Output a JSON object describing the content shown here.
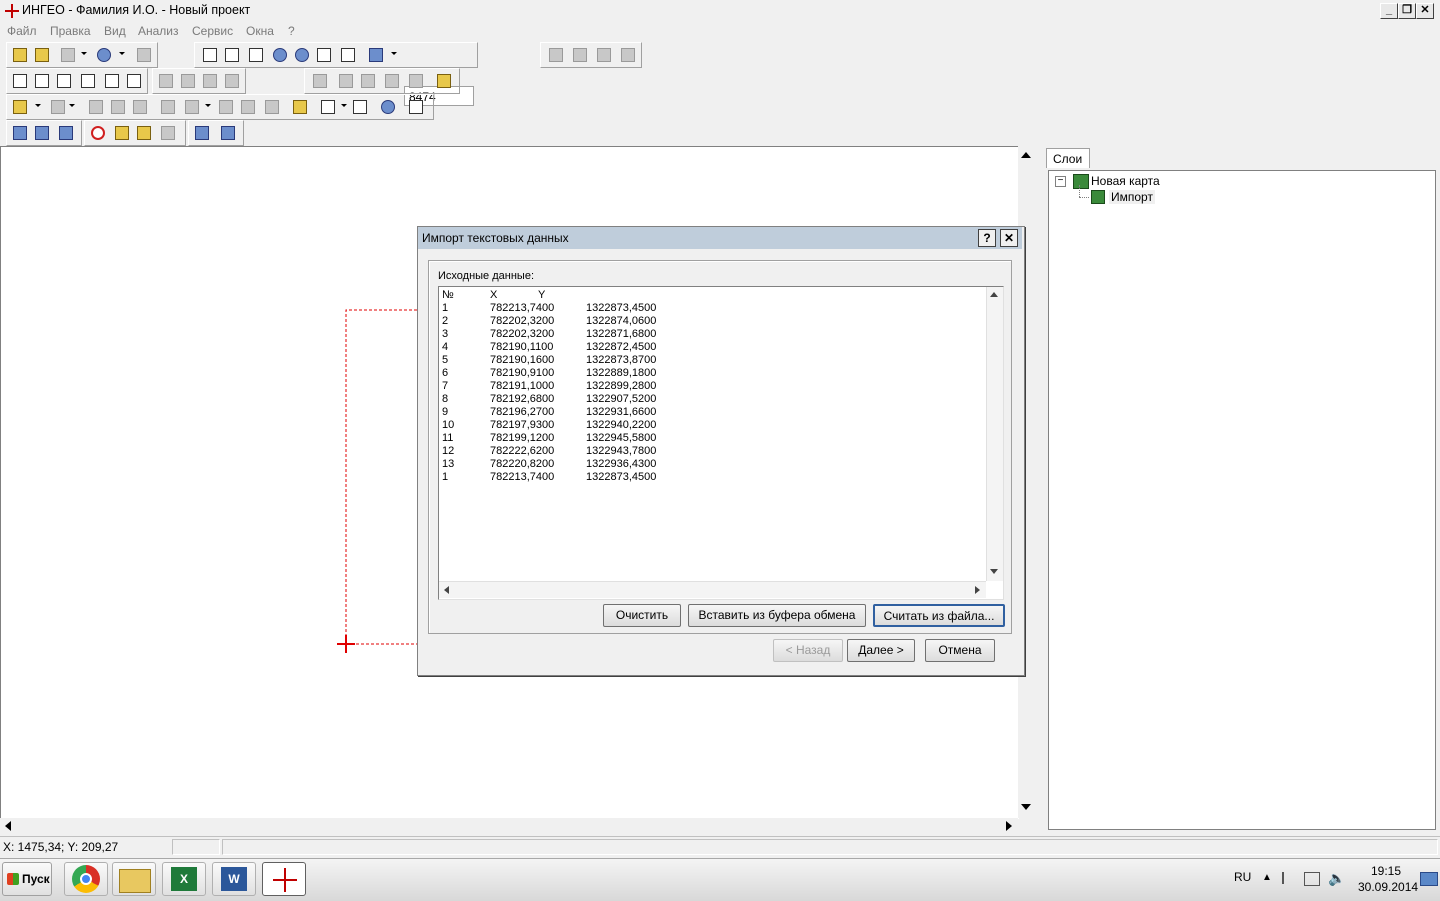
{
  "window": {
    "title": "ИНГЕО - Фамилия И.О. - Новый проект",
    "controls": [
      "minimize-icon",
      "restore-icon",
      "close-icon"
    ]
  },
  "menu": [
    "Файл",
    "Правка",
    "Вид",
    "Анализ",
    "Сервис",
    "Окна",
    "?"
  ],
  "toolbar": {
    "scale_value": "8474"
  },
  "status": {
    "coords": "X: 1475,34; Y: 209,27"
  },
  "layers": {
    "tab_label": "Слои",
    "tree": [
      {
        "label": "Новая карта",
        "children": [
          {
            "label": "Импорт"
          }
        ]
      }
    ]
  },
  "dialog": {
    "title": "Импорт текстовых данных",
    "help_label": "?",
    "close_label": "✕",
    "source_label": "Исходные данные:",
    "columns": [
      "№",
      "X",
      "Y"
    ],
    "rows": [
      [
        "1",
        "782213,7400",
        "1322873,4500"
      ],
      [
        "2",
        "782202,3200",
        "1322874,0600"
      ],
      [
        "3",
        "782202,3200",
        "1322871,6800"
      ],
      [
        "4",
        "782190,1100",
        "1322872,4500"
      ],
      [
        "5",
        "782190,1600",
        "1322873,8700"
      ],
      [
        "6",
        "782190,9100",
        "1322889,1800"
      ],
      [
        "7",
        "782191,1000",
        "1322899,2800"
      ],
      [
        "8",
        "782192,6800",
        "1322907,5200"
      ],
      [
        "9",
        "782196,2700",
        "1322931,6600"
      ],
      [
        "10",
        "782197,9300",
        "1322940,2200"
      ],
      [
        "11",
        "782199,1200",
        "1322945,5800"
      ],
      [
        "12",
        "782222,6200",
        "1322943,7800"
      ],
      [
        "13",
        "782220,8200",
        "1322936,4300"
      ],
      [
        "1",
        "782213,7400",
        "1322873,4500"
      ]
    ],
    "buttons": {
      "clear": "Очистить",
      "paste": "Вставить из буфера обмена",
      "load": "Считать из файла...",
      "back": "< Назад",
      "next": "Далее >",
      "cancel": "Отмена"
    }
  },
  "taskbar": {
    "start_label": "Пуск",
    "apps": [
      "chrome-icon",
      "file-explorer-icon",
      "excel-icon",
      "word-icon",
      "ingeo-icon"
    ],
    "language": "RU",
    "time": "19:15",
    "date": "30.09.2014"
  },
  "colors": {
    "map_marker": "#e00000",
    "dialog_title_bg": "#bfcddb"
  }
}
